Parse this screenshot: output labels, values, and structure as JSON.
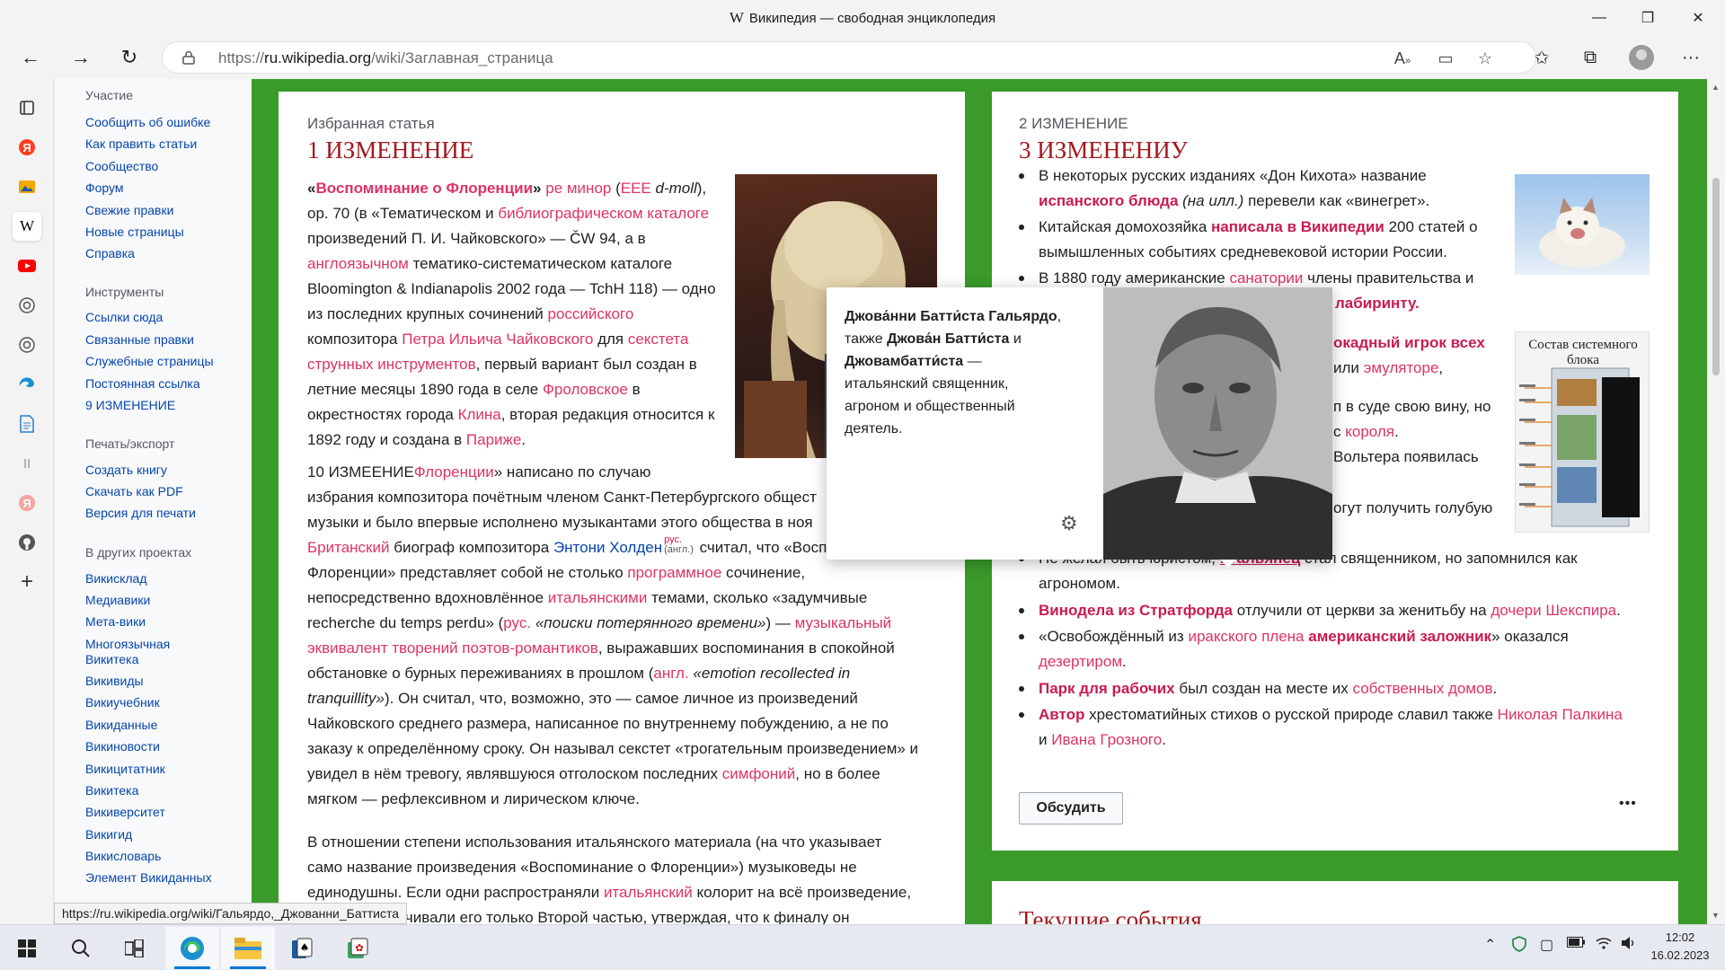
{
  "window": {
    "logo": "W",
    "title": "Википедия — свободная энциклопедия",
    "controls": {
      "minimize": "—",
      "maximize": "❐",
      "close": "✕"
    }
  },
  "browser": {
    "back": "←",
    "forward": "→",
    "refresh": "↻",
    "url_prefix": "https://",
    "url_host": "ru.wikipedia.org",
    "url_path": "/wiki/Заглавная_страница",
    "icons": [
      "read-aloud-icon",
      "immersive-reader-icon",
      "add-favorite-icon",
      "favorites-icon",
      "collections-icon",
      "profile-icon",
      "more-icon"
    ],
    "more": "···"
  },
  "edge_sidebar": [
    "tab-actions-icon",
    "yandex-icon",
    "image-app-icon",
    "wikipedia-icon",
    "youtube-icon",
    "openai-icon",
    "openai-icon-2",
    "edge-icon",
    "docs-icon",
    "pause-icon",
    "yandex-icon-2",
    "github-icon",
    "add-icon"
  ],
  "wiki_nav": {
    "sections": [
      {
        "title": "Участие",
        "links": [
          "Сообщить об ошибке",
          "Как править статьи",
          "Сообщество",
          "Форум",
          "Свежие правки",
          "Новые страницы",
          "Справка"
        ]
      },
      {
        "title": "Инструменты",
        "links": [
          "Ссылки сюда",
          "Связанные правки",
          "Служебные страницы",
          "Постоянная ссылка",
          "9 ИЗМЕНЕНИЕ"
        ]
      },
      {
        "title": "Печать/экспорт",
        "links": [
          "Создать книгу",
          "Скачать как PDF",
          "Версия для печати"
        ]
      },
      {
        "title": "В других проектах",
        "links": [
          "Викисклад",
          "Медиавики",
          "Мета-вики",
          "Многоязычная Викитека",
          "Викивиды",
          "Викиучебник",
          "Викиданные",
          "Викиновости",
          "Викицитатник",
          "Викитека",
          "Викиверситет",
          "Викигид",
          "Викисловарь",
          "Элемент Викиданных"
        ]
      }
    ]
  },
  "featured": {
    "header": "Избранная статья",
    "title": "1 ИЗМЕНЕНИЕ",
    "p1": {
      "l1": [
        "«",
        "Воспоминание о Флоренции",
        "»",
        " ре минор",
        " (",
        "EEE",
        " d-moll",
        "),"
      ],
      "l2": [
        "ор. 70 (в «Тематическом и ",
        "библиографическом каталоге"
      ],
      "l3": "произведений П. И. Чайковского» — ČW 94, а в",
      "l4": [
        "англоязычном",
        " тематико-систематическом каталоге"
      ],
      "l5": "Bloomington & Indianapolis 2002 года — TchH 118) — одно",
      "l6": [
        "из последних крупных сочинений ",
        "российского"
      ],
      "l7": [
        "композитора ",
        "Петра Ильича Чайковского",
        " для ",
        "секстета"
      ],
      "l8": [
        "струнных инструментов",
        ", первый вариант был создан в"
      ],
      "l9": [
        "летние месяцы 1890 года в селе ",
        "Фроловское",
        " в"
      ],
      "l10": [
        "окрестностях города ",
        "Клина",
        ", вторая редакция относится к"
      ],
      "l11": [
        "1892 году и создана в ",
        "Париже",
        "."
      ]
    },
    "p2": {
      "l1": [
        "10 ИЗМЕЕНИЕ",
        "Флоренции",
        "» написано по случаю"
      ],
      "l2": "избрания композитора почётным членом Санкт-Петербургского общест",
      "l3": "музыки и было впервые исполнено музыкантами этого общества в ноя"
    },
    "p3": {
      "l1": [
        "Британский",
        " биограф композитора ",
        "Энтони Холден",
        "рус.",
        "(англ.)",
        " считал, что «Воспоминание о"
      ],
      "l2": "Флоренции» представляет собой не столько программное сочинение,",
      "l2_link": "программное",
      "l3": [
        "непосредственно вдохновлённое ",
        "итальянскими",
        " темами, сколько «задумчивые"
      ],
      "l4": [
        "recherche du temps perdu» (",
        "рус.",
        " «поиски потерянного времени»",
        ") — ",
        "музыкальный"
      ],
      "l5": [
        "эквивалент творений поэтов-романтиков",
        ", выражавших воспоминания в спокойной"
      ],
      "l6": [
        "обстановке о бурных переживаниях в прошлом (",
        "англ.",
        " «emotion recollected in"
      ],
      "l7": [
        "tranquillity»",
        "). Он считал, что, возможно, это — самое личное из произведений"
      ],
      "l8": "Чайковского среднего размера, написанное по внутреннему побуждению, а не по",
      "l9": "заказу к определённому сроку. Он называл секстет «трогательным произведением» и",
      "l10": [
        "увидел в нём тревогу, являвшуюся отголоском последних ",
        "симфоний",
        ", но в более"
      ],
      "l11": "мягком — рефлексивном и лирическом ключе."
    },
    "p4": {
      "l1": "В отношении степени использования итальянского материала (на что указывает",
      "l2": "само название произведения «Воспоминание о Флоренции») музыковеды не",
      "l3": [
        "единодушны. Если одни распространяли ",
        "итальянский",
        " колорит на всё произведение,"
      ],
      "l4": "ничивали его только Второй частью, утверждая, что к финалу он"
    }
  },
  "dyk": {
    "header": "2 ИЗМЕНЕНИЕ",
    "title": "3 ИЗМЕНЕНИУ",
    "items": [
      {
        "l1": [
          "В некоторых русских изданиях «Дон Кихота» название"
        ],
        "l2": [
          "испанского блюда",
          " (на илл.)",
          " перевели как «винегрет»."
        ]
      },
      {
        "l1": [
          "Китайская домохозяйка ",
          "написала в Википедии",
          " 200 статей о"
        ],
        "l2": [
          "вымышленных событиях средневековой истории России."
        ]
      },
      {
        "l1": [
          "В 1880 году американские ",
          "санатории",
          " ",
          "члены правительства и"
        ],
        "l2": [
          "",
          "лабиринту."
        ]
      },
      {
        "l1": [
          "",
          "окадный игрок всех"
        ],
        "l2": [
          "",
          "или ",
          "эмуляторе",
          ","
        ]
      },
      {
        "l1": [
          "",
          "п в суде свою вину, но"
        ],
        "l2": [
          "",
          "с ",
          "короля",
          "."
        ]
      },
      {
        "l1": [
          "",
          "Вольтера появилась"
        ]
      },
      {
        "l1": [
          "",
          "огут получить голубую"
        ]
      },
      {
        "l1": [
          "Не желая быть юристом, ",
          "итальянец",
          " стал священником, но запомнился как"
        ],
        "l2": [
          "агрономом."
        ]
      },
      {
        "l1": [
          "Винодела из Стратфорда",
          " отлучили от церкви за женитьбу на ",
          "дочери Шекспира",
          "."
        ]
      },
      {
        "l1": [
          "«Освобождённый из ",
          "иракского плена",
          " ",
          "американский заложник",
          "» оказался"
        ],
        "l2": [
          "",
          "дезертиром",
          "."
        ]
      },
      {
        "l1": [
          "Парк для рабочих",
          " был создан на месте их ",
          "собственных домов",
          "."
        ]
      },
      {
        "l1": [
          "Автор",
          " хрестоматийных стихов о русской природе славил также ",
          "Николая Палкина"
        ],
        "l2": [
          "и ",
          "Ивана Грозного",
          "."
        ]
      }
    ],
    "discuss": "Обсудить",
    "more": "•••",
    "kitten_label": "kitten-photo",
    "system_block_caption": "Состав системного блока"
  },
  "news": {
    "title": "Текущие события"
  },
  "popup": {
    "b1": "Джова́нни Батти́ста Гальярдо",
    "t1": ",",
    "t2": "также ",
    "b2": "Джова́н Батти́ста",
    "t3": " и",
    "b3": "Джовамбатти́ста",
    "t4": " —",
    "t5": "итальянский священник,",
    "t6": "агроном и общественный",
    "t7": "деятель."
  },
  "status_url": "https://ru.wikipedia.org/wiki/Гальярдо,_Джованни_Баттиста",
  "taskbar": {
    "apps": [
      "windows-start-icon",
      "search-icon",
      "task-view-icon",
      "edge-icon",
      "file-explorer-icon",
      "solitaire-icon",
      "mahjong-icon"
    ],
    "tray": [
      "chevron-up-icon",
      "defender-icon",
      "meet-icon",
      "battery-icon",
      "wifi-icon",
      "volume-icon"
    ],
    "time": "12:02",
    "date": "16.02.2023"
  },
  "colors": {
    "wiki_link": "#0645ad",
    "wiki_red_link": "#dd3366",
    "green_frame": "#3a9a2a",
    "title_red": "#a3181e"
  }
}
